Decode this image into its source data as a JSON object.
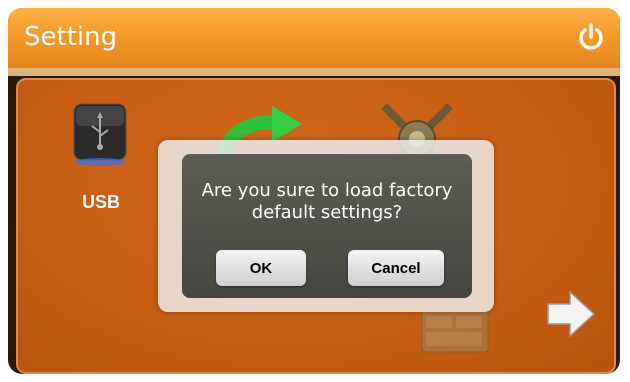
{
  "window": {
    "title": "Setting",
    "power_icon": "power-icon"
  },
  "icons": {
    "usb": {
      "label": "USB",
      "icon": "usb-drive-icon"
    },
    "refresh": {
      "icon": "refresh-arrow-icon"
    },
    "satellite": {
      "icon": "satellite-icon"
    },
    "next": {
      "icon": "next-arrow-icon"
    }
  },
  "dialog": {
    "message": "Are you sure to load factory default settings?",
    "ok_label": "OK",
    "cancel_label": "Cancel"
  },
  "colors": {
    "title_bar": "#f39a2a",
    "panel": "#c85f14",
    "dialog": "#4f4f49"
  }
}
